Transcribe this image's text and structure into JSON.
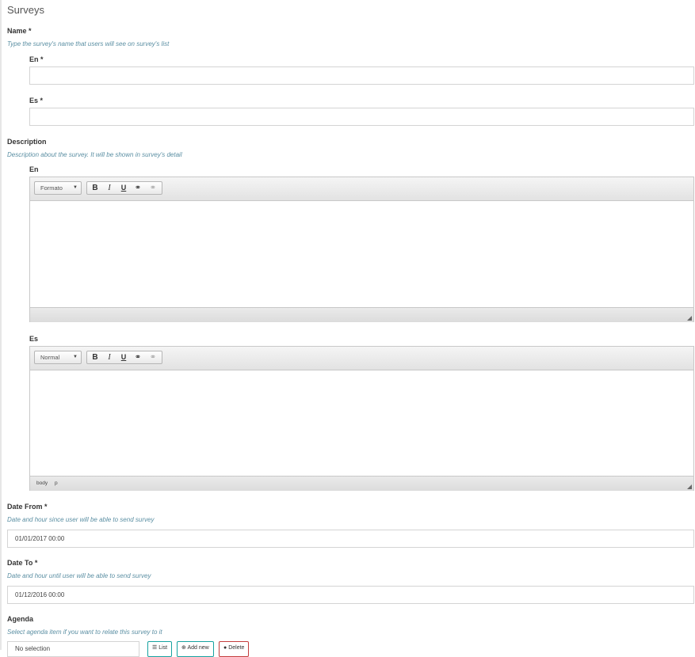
{
  "page": {
    "title": "Surveys"
  },
  "name_field": {
    "label": "Name *",
    "hint": "Type the survey's name that users will see on survey's list",
    "en": {
      "label": "En *",
      "value": ""
    },
    "es": {
      "label": "Es *",
      "value": ""
    }
  },
  "description_field": {
    "label": "Description",
    "hint": "Description about the survey. It will be shown in survey's detail",
    "en": {
      "label": "En",
      "format_value": "Formato",
      "path": []
    },
    "es": {
      "label": "Es",
      "format_value": "Normal",
      "path": [
        "body",
        "p"
      ]
    },
    "toolbar": {
      "bold": "B",
      "italic": "I",
      "underline": "U",
      "link": "⚭",
      "unlink": "⚭"
    }
  },
  "date_from": {
    "label": "Date From *",
    "hint": "Date and hour since user will be able to send survey",
    "value": "01/01/2017 00:00"
  },
  "date_to": {
    "label": "Date To *",
    "hint": "Date and hour until user will be able to send survey",
    "value": "01/12/2016 00:00"
  },
  "agenda": {
    "label": "Agenda",
    "hint": "Select agenda item if you want to relate this survey to it",
    "select_value": "No selection",
    "buttons": {
      "list": "List",
      "add_new": "Add new",
      "delete": "Delete"
    }
  },
  "colors": {
    "hint": "#5b8fa3",
    "teal": "#17a2a0",
    "red": "#c43d3d"
  }
}
